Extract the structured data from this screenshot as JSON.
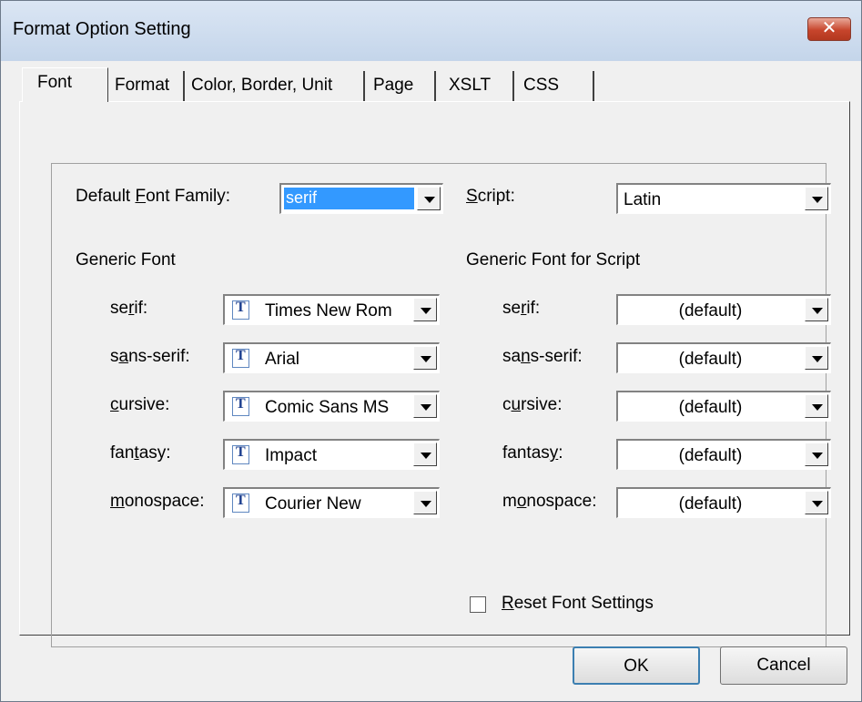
{
  "window": {
    "title": "Format Option Setting",
    "close_label": "✕"
  },
  "tabs": [
    {
      "label": "Font",
      "active": true
    },
    {
      "label": "Format"
    },
    {
      "label": "Color, Border, Unit"
    },
    {
      "label": "Page"
    },
    {
      "label": "XSLT"
    },
    {
      "label": "CSS"
    }
  ],
  "default_font_family": {
    "label_pre": "Default ",
    "label_key": "F",
    "label_post": "ont Family:",
    "value": "serif"
  },
  "script": {
    "label_key": "S",
    "label_post": "cript:",
    "value": "Latin"
  },
  "generic_font": {
    "heading": "Generic Font",
    "rows": [
      {
        "label_pre": "se",
        "label_key": "r",
        "label_post": "if:",
        "value": "Times New Rom"
      },
      {
        "label_pre": "s",
        "label_key": "a",
        "label_post": "ns-serif:",
        "value": "Arial"
      },
      {
        "label_pre": "",
        "label_key": "c",
        "label_post": "ursive:",
        "value": "Comic Sans MS"
      },
      {
        "label_pre": "fan",
        "label_key": "t",
        "label_post": "asy:",
        "value": "Impact"
      },
      {
        "label_pre": "",
        "label_key": "m",
        "label_post": "onospace:",
        "value": "Courier New"
      }
    ]
  },
  "generic_font_script": {
    "heading": "Generic Font for Script",
    "rows": [
      {
        "label_pre": "se",
        "label_key": "r",
        "label_post": "if:",
        "value": "(default)"
      },
      {
        "label_pre": "sa",
        "label_key": "n",
        "label_post": "s-serif:",
        "value": "(default)"
      },
      {
        "label_pre": "c",
        "label_key": "u",
        "label_post": "rsive:",
        "value": "(default)"
      },
      {
        "label_pre": "fantas",
        "label_key": "y",
        "label_post": ":",
        "value": "(default)"
      },
      {
        "label_pre": "m",
        "label_key": "o",
        "label_post": "nospace:",
        "value": "(default)"
      }
    ]
  },
  "reset": {
    "label_key": "R",
    "label_post": "eset Font Settings",
    "checked": false
  },
  "buttons": {
    "ok": "OK",
    "cancel": "Cancel"
  }
}
